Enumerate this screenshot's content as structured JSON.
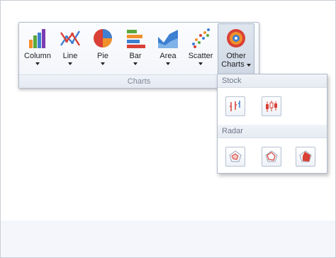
{
  "ribbon": {
    "group_caption": "Charts",
    "buttons": [
      {
        "label": "Column",
        "icon": "column-chart-icon"
      },
      {
        "label": "Line",
        "icon": "line-chart-icon"
      },
      {
        "label": "Pie",
        "icon": "pie-chart-icon"
      },
      {
        "label": "Bar",
        "icon": "bar-chart-icon"
      },
      {
        "label": "Area",
        "icon": "area-chart-icon"
      },
      {
        "label": "Scatter",
        "icon": "scatter-chart-icon"
      },
      {
        "label_line1": "Other",
        "label_line2": "Charts",
        "icon": "other-charts-icon"
      }
    ]
  },
  "dropdown": {
    "sections": [
      {
        "title": "Stock",
        "items": [
          "stock-high-low-close-icon",
          "stock-candlestick-icon"
        ]
      },
      {
        "title": "Radar",
        "items": [
          "radar-point-icon",
          "radar-line-icon",
          "radar-area-icon"
        ]
      }
    ]
  },
  "colors": {
    "accent_blue": "#3d7fd1",
    "accent_red": "#d94036",
    "accent_orange": "#f0902a",
    "accent_green": "#5aa83a"
  }
}
